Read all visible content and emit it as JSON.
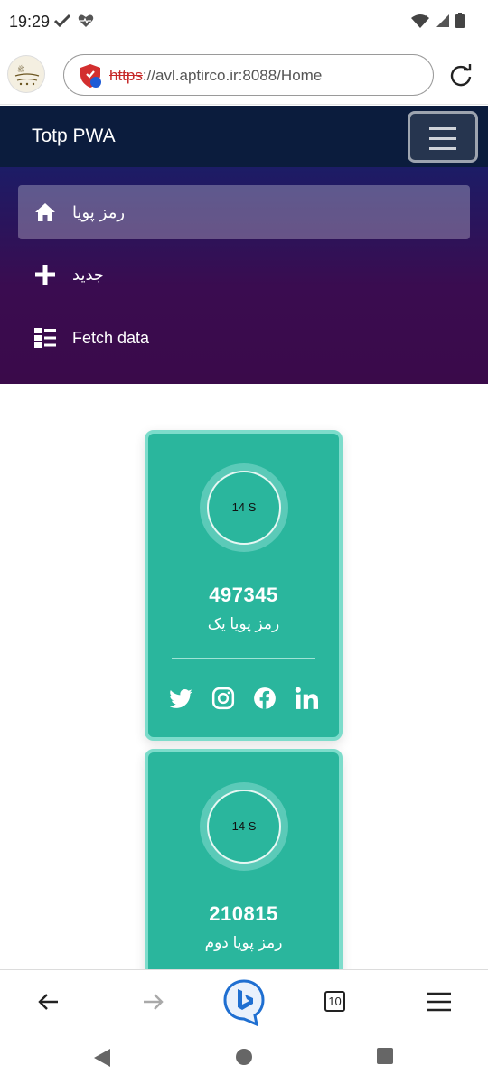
{
  "status_bar": {
    "time": "19:29"
  },
  "browser": {
    "url_scheme": "https",
    "url_rest": "://avl.aptirco.ir:8088/Home",
    "tabs_count": "10"
  },
  "app": {
    "title": "Totp PWA"
  },
  "nav": {
    "items": [
      {
        "label": "رمز پویا",
        "icon": "home-icon",
        "active": true
      },
      {
        "label": "جدید",
        "icon": "plus-icon",
        "active": false
      },
      {
        "label": "Fetch data",
        "icon": "list-icon",
        "active": false
      }
    ]
  },
  "cards": [
    {
      "timer": "14 S",
      "code": "497345",
      "label": "رمز پویا یک",
      "socials": [
        "twitter-icon",
        "instagram-icon",
        "facebook-icon",
        "linkedin-icon"
      ]
    },
    {
      "timer": "14 S",
      "code": "210815",
      "label": "رمز پویا دوم"
    }
  ],
  "colors": {
    "header_bg": "#0b1c3d",
    "nav_gradient_top": "#1c1c66",
    "nav_gradient_bottom": "#3a0a4a",
    "card_bg": "#2ab69d",
    "card_border": "#7ddccb",
    "url_scheme_red": "#c62828",
    "bing_blue": "#1f6fd1"
  }
}
